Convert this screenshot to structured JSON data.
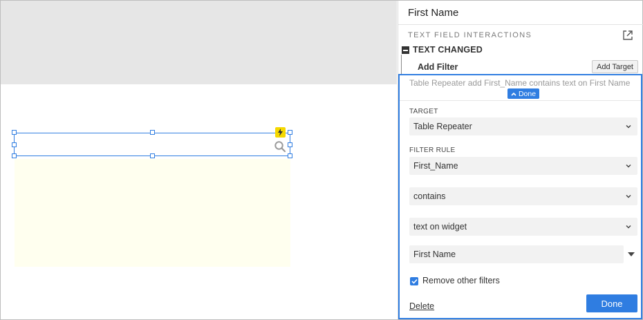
{
  "canvas": {
    "colors": {
      "top_band": "#e6e6e6",
      "repeater_fill": "#ffffef",
      "selection": "#2f7de1",
      "lightning": "#f5d800"
    },
    "icons": [
      "lightning-icon",
      "search-icon"
    ]
  },
  "panel": {
    "title": "First Name",
    "section_label": "TEXT FIELD INTERACTIONS",
    "event": {
      "label": "TEXT CHANGED",
      "collapse_icon": "minus-box-icon"
    },
    "action": {
      "label": "Add Filter",
      "add_target_label": "Add Target"
    },
    "editor": {
      "summary": "Table Repeater add First_Name contains text on First Name",
      "done_chip_label": "Done",
      "target": {
        "label": "TARGET",
        "value": "Table Repeater"
      },
      "filter_rule": {
        "label": "FILTER RULE",
        "column": "First_Name",
        "operator": "contains",
        "source": "text on widget",
        "widget": "First Name"
      },
      "remove_other_filters": {
        "label": "Remove other filters",
        "checked": true
      },
      "delete_label": "Delete",
      "done_label": "Done"
    }
  },
  "accent_color": "#2f7de1"
}
